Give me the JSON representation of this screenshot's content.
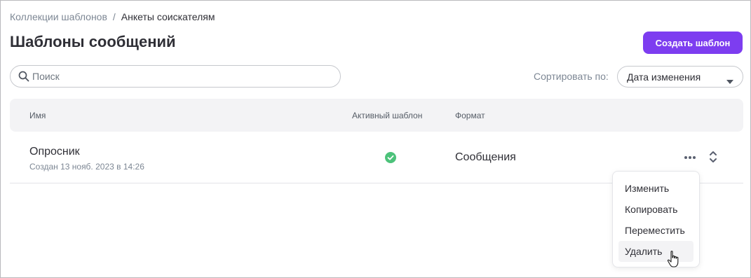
{
  "breadcrumb": {
    "parent": "Коллекции шаблонов",
    "separator": "/",
    "current": "Анкеты соискателям"
  },
  "page": {
    "title": "Шаблоны сообщений",
    "create_button": "Создать шаблон"
  },
  "search": {
    "placeholder": "Поиск",
    "value": ""
  },
  "sort": {
    "label": "Сортировать по:",
    "selected": "Дата изменения"
  },
  "table": {
    "headers": {
      "name": "Имя",
      "active": "Активный шаблон",
      "format": "Формат"
    },
    "rows": [
      {
        "name": "Опросник",
        "created": "Создан 13 нояб. 2023 в 14:26",
        "active": true,
        "format": "Сообщения"
      }
    ]
  },
  "context_menu": {
    "items": [
      "Изменить",
      "Копировать",
      "Переместить",
      "Удалить"
    ],
    "hovered": "Удалить"
  },
  "colors": {
    "accent": "#7d3df0",
    "success": "#4cc27a",
    "muted_text": "#7d8794"
  },
  "icons": {
    "search": "search-icon",
    "sort_caret": "caret-down-icon",
    "active": "check-circle-icon",
    "more": "more-horizontal-icon",
    "expand": "chevron-up-down-icon",
    "cursor": "hand-pointer-icon"
  }
}
